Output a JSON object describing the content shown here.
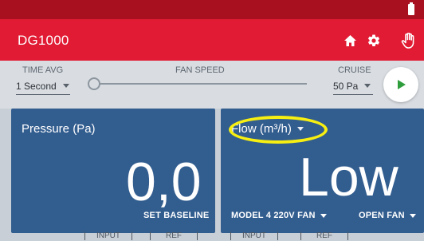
{
  "app": {
    "title": "DG1000"
  },
  "toolbar": {
    "icons": [
      "home-icon",
      "gear-icon",
      "hand-icon"
    ]
  },
  "controls": {
    "time_avg": {
      "label": "TIME AVG",
      "value": "1 Second"
    },
    "fan_speed": {
      "label": "FAN SPEED",
      "level": 0
    },
    "cruise": {
      "label": "CRUISE",
      "value": "50 Pa"
    },
    "play_icon": "play-icon"
  },
  "pressure_card": {
    "title": "Pressure (Pa)",
    "value": "0,0",
    "action": "SET BASELINE"
  },
  "flow_card": {
    "title": "Flow (m³/h)",
    "value": "Low",
    "fan_model": "MODEL 4 220V FAN",
    "fan_config": "OPEN FAN"
  },
  "bottom_tabs": {
    "left_input": "INPUT",
    "left_ref": "REF",
    "right_input": "INPUT",
    "right_ref": "REF"
  },
  "colors": {
    "status_bar": "#a8101f",
    "app_bar": "#e01b33",
    "card": "#325d8f",
    "play_accent": "#2e9d3c",
    "highlight": "#f7ef11"
  }
}
